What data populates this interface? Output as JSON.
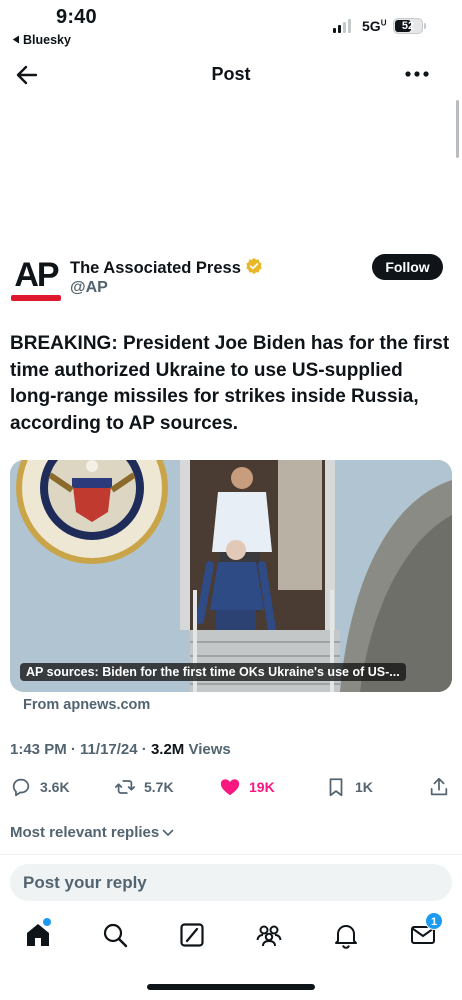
{
  "status_bar": {
    "time": "9:40",
    "back_app": "Bluesky",
    "network": "5G",
    "battery": "52"
  },
  "header": {
    "title": "Post"
  },
  "author": {
    "name": "The Associated Press",
    "handle": "@AP",
    "avatar_text": "AP",
    "verified_color": "#e8b829"
  },
  "follow_label": "Follow",
  "post": {
    "text": "BREAKING: President Joe Biden has for the first time authorized Ukraine to use US-supplied long-range missiles for strikes inside Russia, according to AP sources.",
    "media_caption": "AP sources: Biden for the first time OKs Ukraine's use of US-...",
    "source": "From apnews.com"
  },
  "meta": {
    "time": "1:43 PM",
    "date": "11/17/24",
    "views_count": "3.2M",
    "views_label": "Views"
  },
  "actions": {
    "replies": "3.6K",
    "reposts": "5.7K",
    "likes": "19K",
    "bookmarks": "1K"
  },
  "replies_sort": "Most relevant replies",
  "reply_placeholder": "Post your reply",
  "tab_bar": {
    "items": [
      "home-icon",
      "search-icon",
      "grok-icon",
      "communities-icon",
      "notifications-icon",
      "messages-icon"
    ],
    "messages_badge": "1"
  },
  "colors": {
    "like": "#f91880",
    "accent": "#1d9bf0",
    "text": "#0f1419",
    "muted": "#536471",
    "ap_red": "#e0182d"
  }
}
